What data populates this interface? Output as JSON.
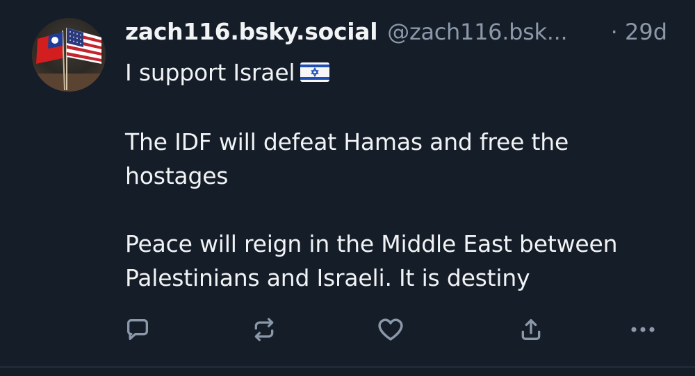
{
  "post": {
    "author": {
      "display_name": "zach116.bsky.social",
      "handle": "@zach116.bsk...",
      "avatar_icon": "taiwan-usa-flags-avatar"
    },
    "timestamp": "· 29d",
    "text": {
      "line1": "I support Israel",
      "line1_emoji": "israel-flag-emoji",
      "para2_line1": "The IDF will defeat Hamas and free the",
      "para2_line2": "hostages",
      "para3_line1": "Peace will reign in the Middle East between",
      "para3_line2": "Palestinians and Israeli. It is destiny"
    },
    "actions": [
      {
        "name": "reply",
        "icon": "comment-icon"
      },
      {
        "name": "repost",
        "icon": "repost-icon"
      },
      {
        "name": "like",
        "icon": "heart-icon"
      },
      {
        "name": "share",
        "icon": "share-icon"
      },
      {
        "name": "more",
        "icon": "more-icon"
      }
    ]
  },
  "colors": {
    "background": "#151d28",
    "text_primary": "#f1f3f5",
    "text_secondary": "#8b98a9",
    "icon": "#8b98a9",
    "divider": "#222c3a"
  }
}
